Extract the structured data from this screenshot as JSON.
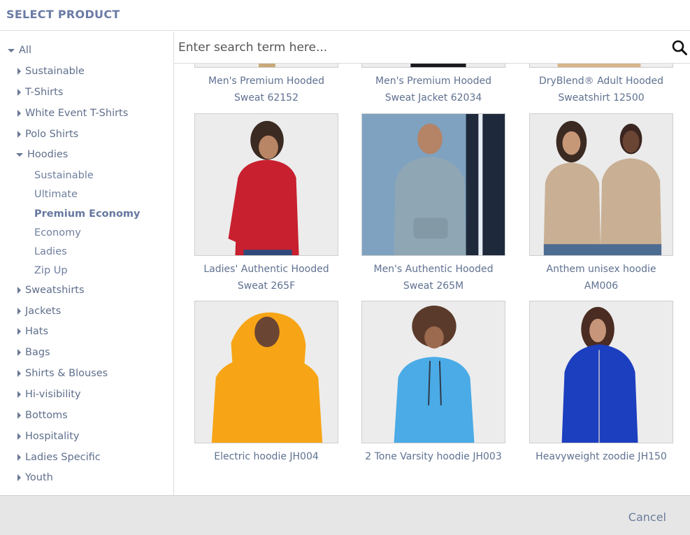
{
  "dialog": {
    "title": "SELECT PRODUCT"
  },
  "search": {
    "placeholder": "Enter search term here..."
  },
  "tree": {
    "root": "All",
    "items": [
      {
        "label": "Sustainable"
      },
      {
        "label": "T-Shirts"
      },
      {
        "label": "White Event T-Shirts"
      },
      {
        "label": "Polo Shirts"
      },
      {
        "label": "Hoodies",
        "expanded": true
      },
      {
        "label": "Sweatshirts"
      },
      {
        "label": "Jackets"
      },
      {
        "label": "Hats"
      },
      {
        "label": "Bags"
      },
      {
        "label": "Shirts & Blouses"
      },
      {
        "label": "Hi-visibility"
      },
      {
        "label": "Bottoms"
      },
      {
        "label": "Hospitality"
      },
      {
        "label": "Ladies Specific"
      },
      {
        "label": "Youth"
      }
    ],
    "hoodies_children": [
      {
        "label": "Sustainable"
      },
      {
        "label": "Ultimate"
      },
      {
        "label": "Premium Economy",
        "active": true
      },
      {
        "label": "Economy"
      },
      {
        "label": "Ladies"
      },
      {
        "label": "Zip Up"
      }
    ]
  },
  "products": {
    "row0": [
      {
        "line1": "Men's Premium Hooded",
        "line2": "Sweat 62152"
      },
      {
        "line1": "Men's Premium Hooded",
        "line2": "Sweat Jacket 62034"
      },
      {
        "line1": "DryBlend® Adult Hooded",
        "line2": "Sweatshirt 12500"
      }
    ],
    "row1": [
      {
        "line1": "Ladies' Authentic Hooded",
        "line2": "Sweat 265F",
        "color": "#c8202f"
      },
      {
        "line1": "Men's Authentic Hooded",
        "line2": "Sweat 265M",
        "color": "#8fa7b4"
      },
      {
        "line1": "Anthem unisex hoodie AM006",
        "line2": "",
        "color": "#c9b094"
      }
    ],
    "row2": [
      {
        "line1": "Electric hoodie JH004",
        "line2": "",
        "color": "#f7a516"
      },
      {
        "line1": "2 Tone Varsity hoodie JH003",
        "line2": "",
        "color": "#4aabe6"
      },
      {
        "line1": "Heavyweight zoodie JH150",
        "line2": "",
        "color": "#1c3fc0"
      }
    ]
  },
  "footer": {
    "cancel_label": "Cancel"
  }
}
